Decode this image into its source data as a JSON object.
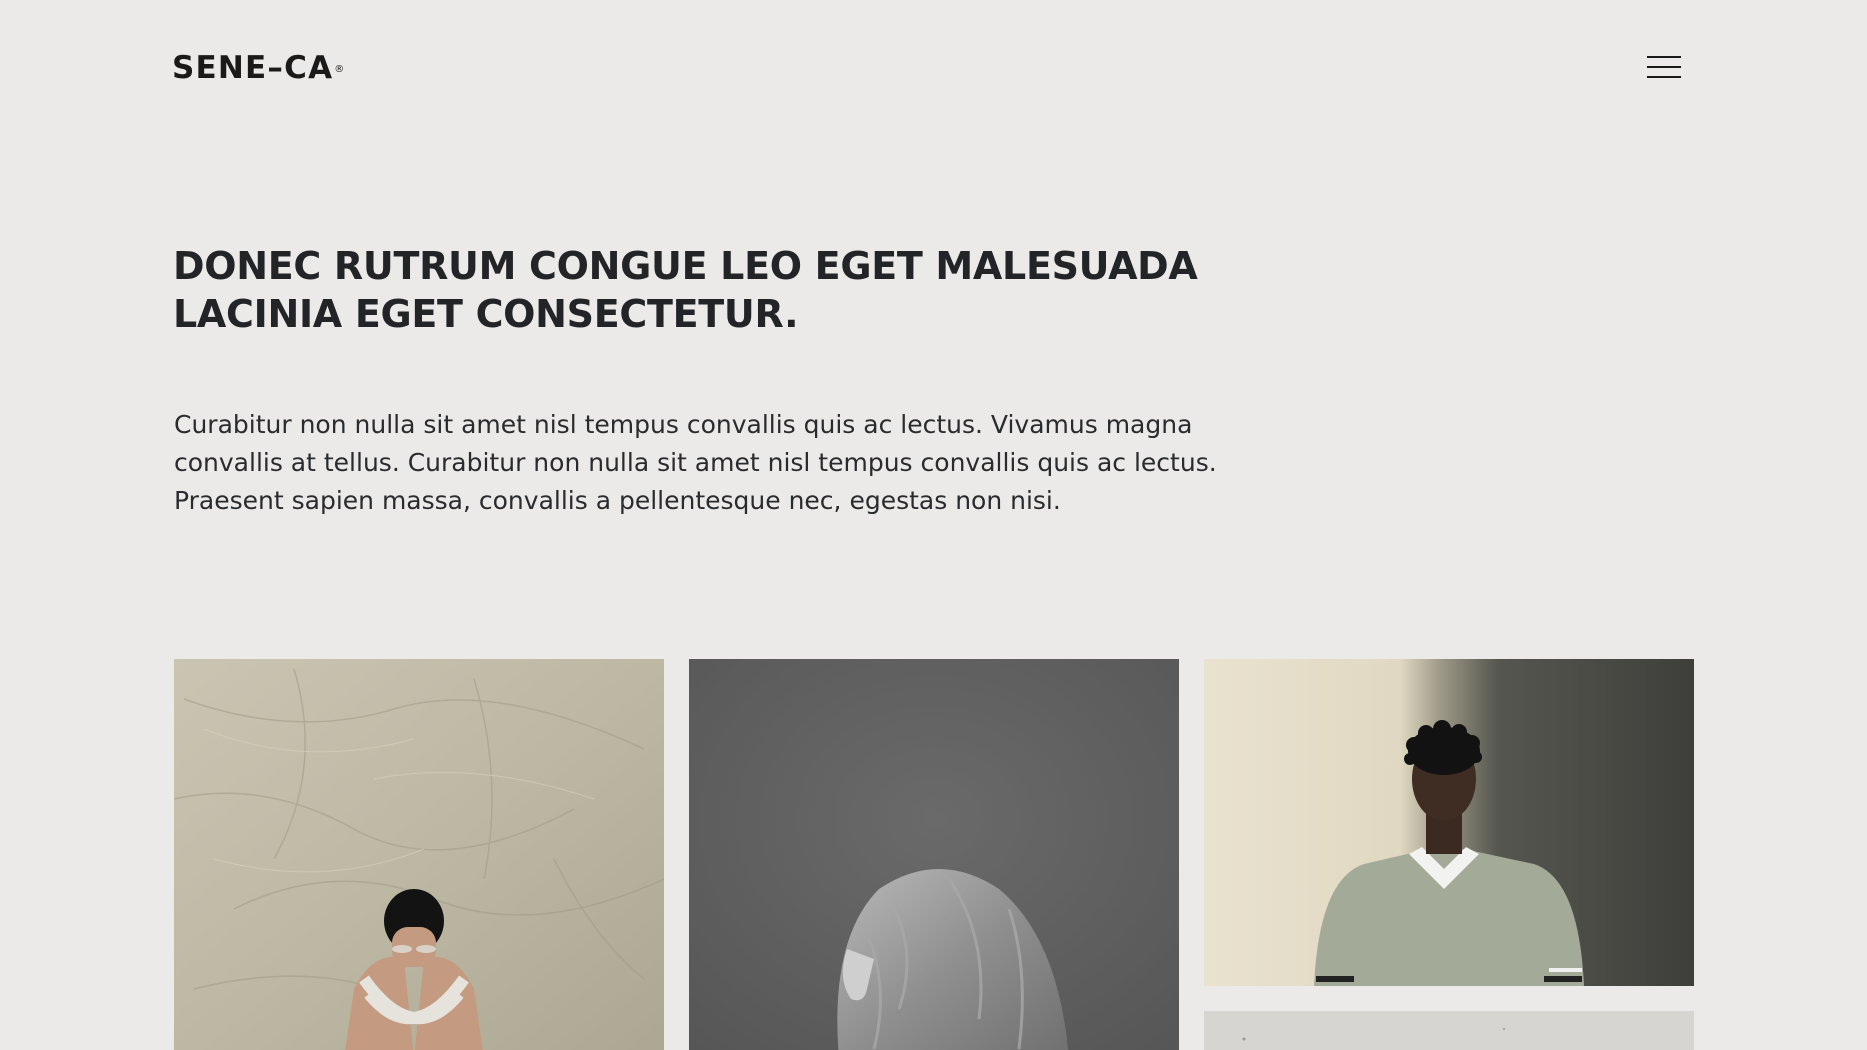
{
  "header": {
    "logo_text": "SENE–CA",
    "logo_mark": "®",
    "menu_icon": "hamburger-menu-icon"
  },
  "hero": {
    "headline_line1": "DONEC RUTRUM CONGUE LEO EGET MALESUADA",
    "headline_line2": "LACINIA EGET CONSECTETUR.",
    "intro": "Curabitur non nulla sit amet nisl tempus convallis quis ac lectus. Vivamus magna convallis at tellus. Curabitur non nulla sit amet nisl tempus convallis quis ac lectus. Praesent sapien massa, convallis a pellentesque nec, egestas non nisi."
  },
  "gallery": {
    "items": [
      {
        "subject": "person sitting hugging knees against beige cloth backdrop",
        "tone": "#bdb9a6"
      },
      {
        "subject": "grayscale portrait of woman with wavy hair looking up",
        "tone": "#5e5e5e"
      },
      {
        "subject": "man in sage green sweater against cream wall",
        "tone": "#e4dcc7"
      },
      {
        "subject": "light gray photo partially visible",
        "tone": "#d6d5d2"
      }
    ]
  },
  "colors": {
    "background": "#ebeae8",
    "text": "#1f1f1f"
  }
}
